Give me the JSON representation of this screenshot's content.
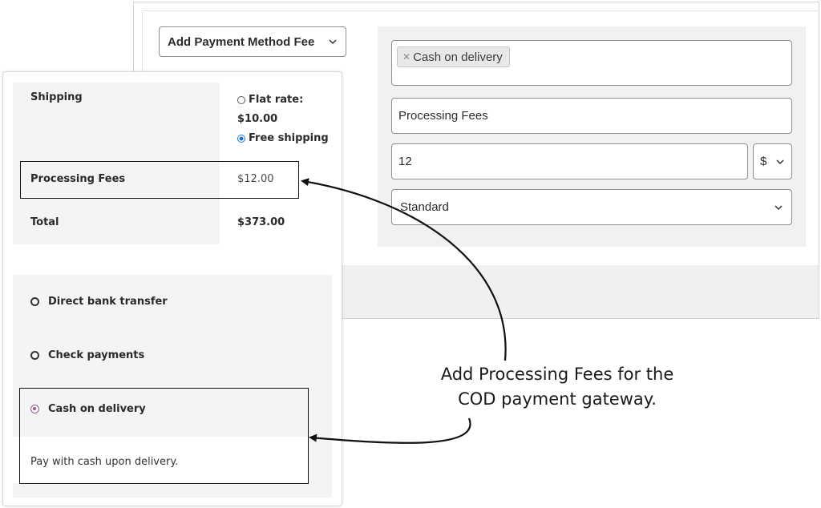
{
  "admin": {
    "fee_type_select": "Add Payment Method Fee",
    "gateway_tag": "Cash on delivery",
    "fee_title": "Processing Fees",
    "fee_amount": "12",
    "currency": "$",
    "tax_class": "Standard"
  },
  "checkout": {
    "shipping_label": "Shipping",
    "shipping_options": [
      {
        "label": "Flat rate:",
        "price": "$10.00",
        "selected": false
      },
      {
        "label": "Free shipping",
        "selected": true
      }
    ],
    "fees_label": "Processing Fees",
    "fees_value": "$12.00",
    "total_label": "Total",
    "total_value": "$373.00",
    "payment_methods": [
      {
        "label": "Direct bank transfer",
        "selected": false
      },
      {
        "label": "Check payments",
        "selected": false
      },
      {
        "label": "Cash on delivery",
        "selected": true
      }
    ],
    "cod_description": "Pay with cash upon delivery."
  },
  "annotation": {
    "line1": "Add Processing Fees for the",
    "line2": "COD payment gateway."
  },
  "colors": {
    "accent_purple": "#96588a",
    "radio_blue": "#1e6fd9",
    "border_gray": "#8c8f94"
  }
}
